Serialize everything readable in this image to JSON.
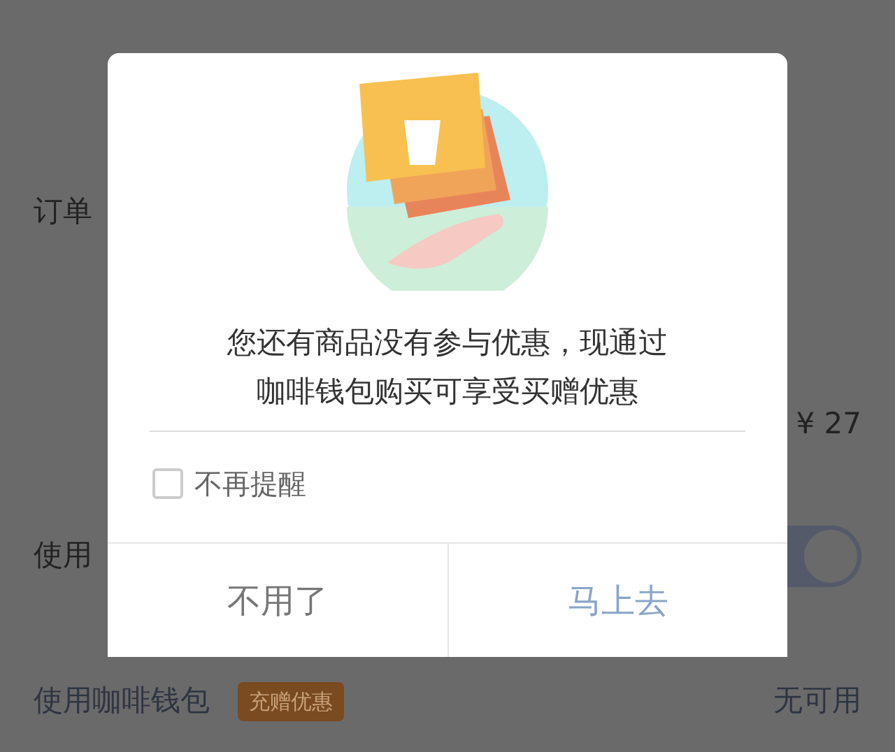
{
  "page_rows": [
    {
      "kind": "text",
      "label": "订单"
    },
    {
      "kind": "price",
      "value": "¥ 27"
    },
    {
      "kind": "toggle",
      "label": "使用",
      "on": true
    },
    {
      "kind": "wallet",
      "label": "使用咖啡钱包",
      "badge": "充赠优惠",
      "value": "无可用"
    }
  ],
  "dialog": {
    "message": [
      "您还有商品没有参与优惠，现通过",
      "咖啡钱包购买可享受买赠优惠"
    ],
    "checkbox": {
      "label": "不再提醒",
      "checked": false
    },
    "buttons": [
      {
        "label": "不用了",
        "kind": "cancel"
      },
      {
        "label": "马上去",
        "kind": "confirm"
      }
    ]
  }
}
